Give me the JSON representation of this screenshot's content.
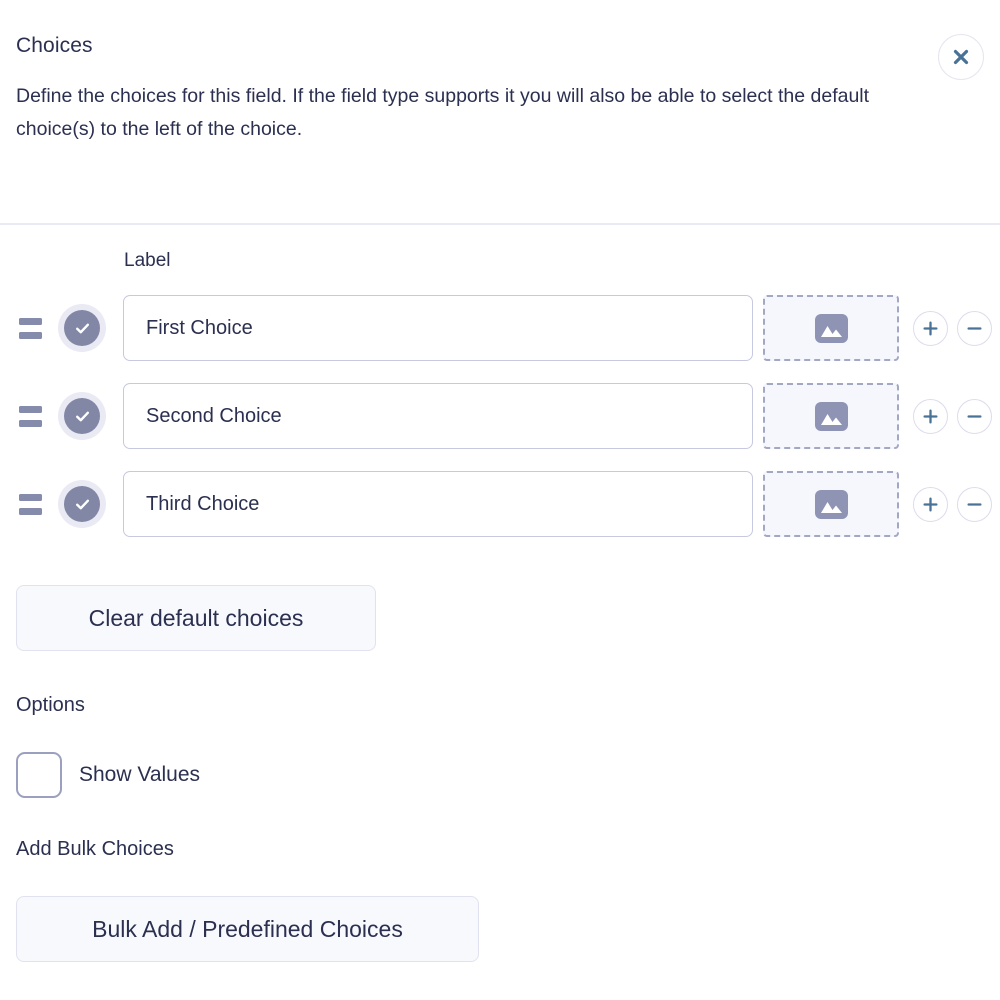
{
  "panel": {
    "title": "Choices",
    "description": "Define the choices for this field. If the field type supports it you will also be able to select the default choice(s) to the left of the choice.",
    "close_label": "Close"
  },
  "choices_table": {
    "column_header_label": "Label",
    "rows": [
      {
        "label_value": "First Choice",
        "label_placeholder": "Label",
        "is_default": true,
        "image_placeholder_name": "image-icon",
        "add_label": "+",
        "remove_label": "−"
      },
      {
        "label_value": "Second Choice",
        "label_placeholder": "Label",
        "is_default": true,
        "image_placeholder_name": "image-icon",
        "add_label": "+",
        "remove_label": "−"
      },
      {
        "label_value": "Third Choice",
        "label_placeholder": "Label",
        "is_default": true,
        "image_placeholder_name": "image-icon",
        "add_label": "+",
        "remove_label": "−"
      }
    ],
    "clear_defaults_label": "Clear default choices"
  },
  "options": {
    "heading": "Options",
    "show_values_label": "Show Values",
    "show_values_checked": false
  },
  "bulk": {
    "heading": "Add Bulk Choices",
    "button_label": "Bulk Add / Predefined Choices"
  },
  "colors": {
    "text": "#2b3050",
    "accent_blue": "#4a7296",
    "toggle_fill": "#8287a6",
    "toggle_ring": "#eaeaf4",
    "border": "#c6c9e0",
    "divider": "#eaeaf6",
    "button_bg": "#f8f9fd",
    "dashed_border": "#a2a7c4"
  }
}
